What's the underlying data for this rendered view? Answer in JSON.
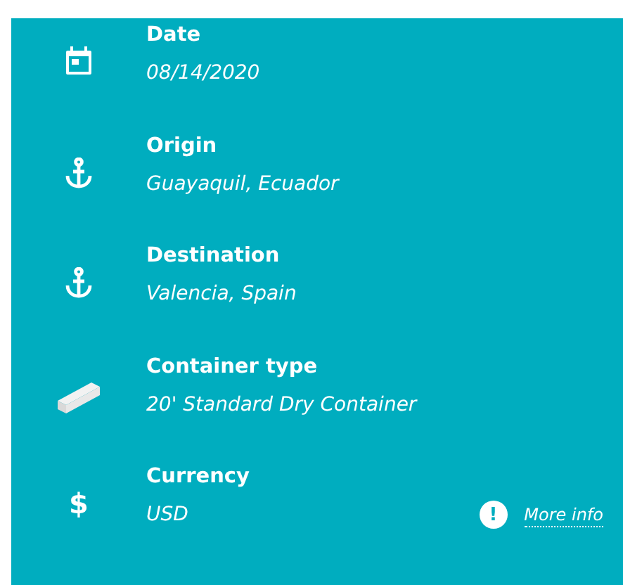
{
  "details": [
    {
      "kind": "calendar",
      "label": "Date",
      "value": "08/14/2020"
    },
    {
      "kind": "anchor",
      "label": "Origin",
      "value": "Guayaquil, Ecuador"
    },
    {
      "kind": "anchor",
      "label": "Destination",
      "value": "Valencia, Spain"
    },
    {
      "kind": "container",
      "label": "Container type",
      "value": "20' Standard Dry Container"
    },
    {
      "kind": "symbol",
      "symbol": "$",
      "label": "Currency",
      "value": "USD"
    }
  ],
  "more_info": {
    "icon_text": "!",
    "label": "More info"
  }
}
